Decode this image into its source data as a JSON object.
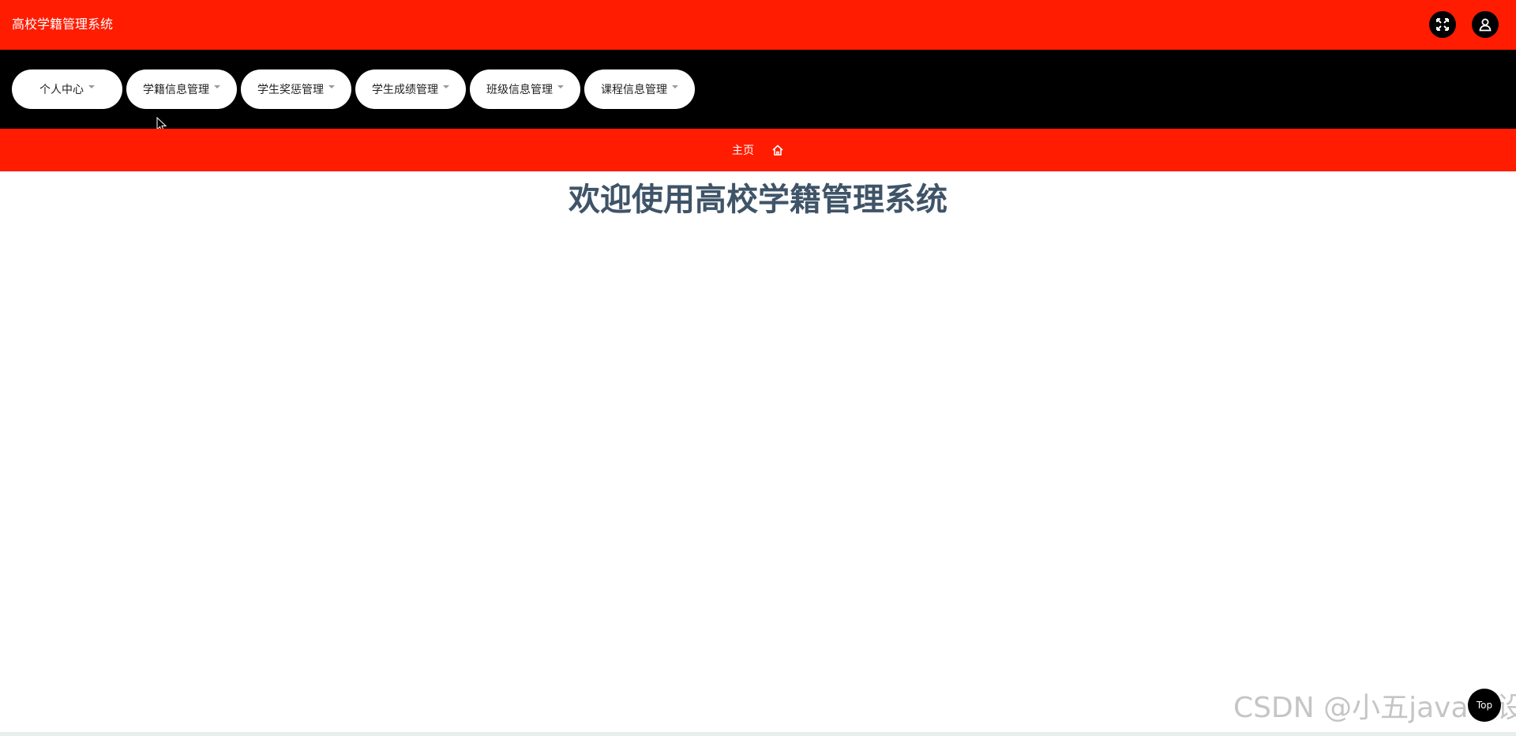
{
  "header": {
    "title": "高校学籍管理系统",
    "fullscreen_icon": "fullscreen-icon",
    "user_icon": "user-icon"
  },
  "nav": {
    "items": [
      {
        "label": "个人中心"
      },
      {
        "label": "学籍信息管理"
      },
      {
        "label": "学生奖惩管理"
      },
      {
        "label": "学生成绩管理"
      },
      {
        "label": "班级信息管理"
      },
      {
        "label": "课程信息管理"
      }
    ]
  },
  "breadcrumb": {
    "label": "主页",
    "icon": "home-icon"
  },
  "main": {
    "welcome": "欢迎使用高校学籍管理系统"
  },
  "back_to_top": {
    "label": "Top"
  },
  "watermark": "CSDN @小五java毕设",
  "colors": {
    "brand_red": "#ff1c00",
    "nav_bg": "#000000",
    "title_text": "#3f5468"
  }
}
